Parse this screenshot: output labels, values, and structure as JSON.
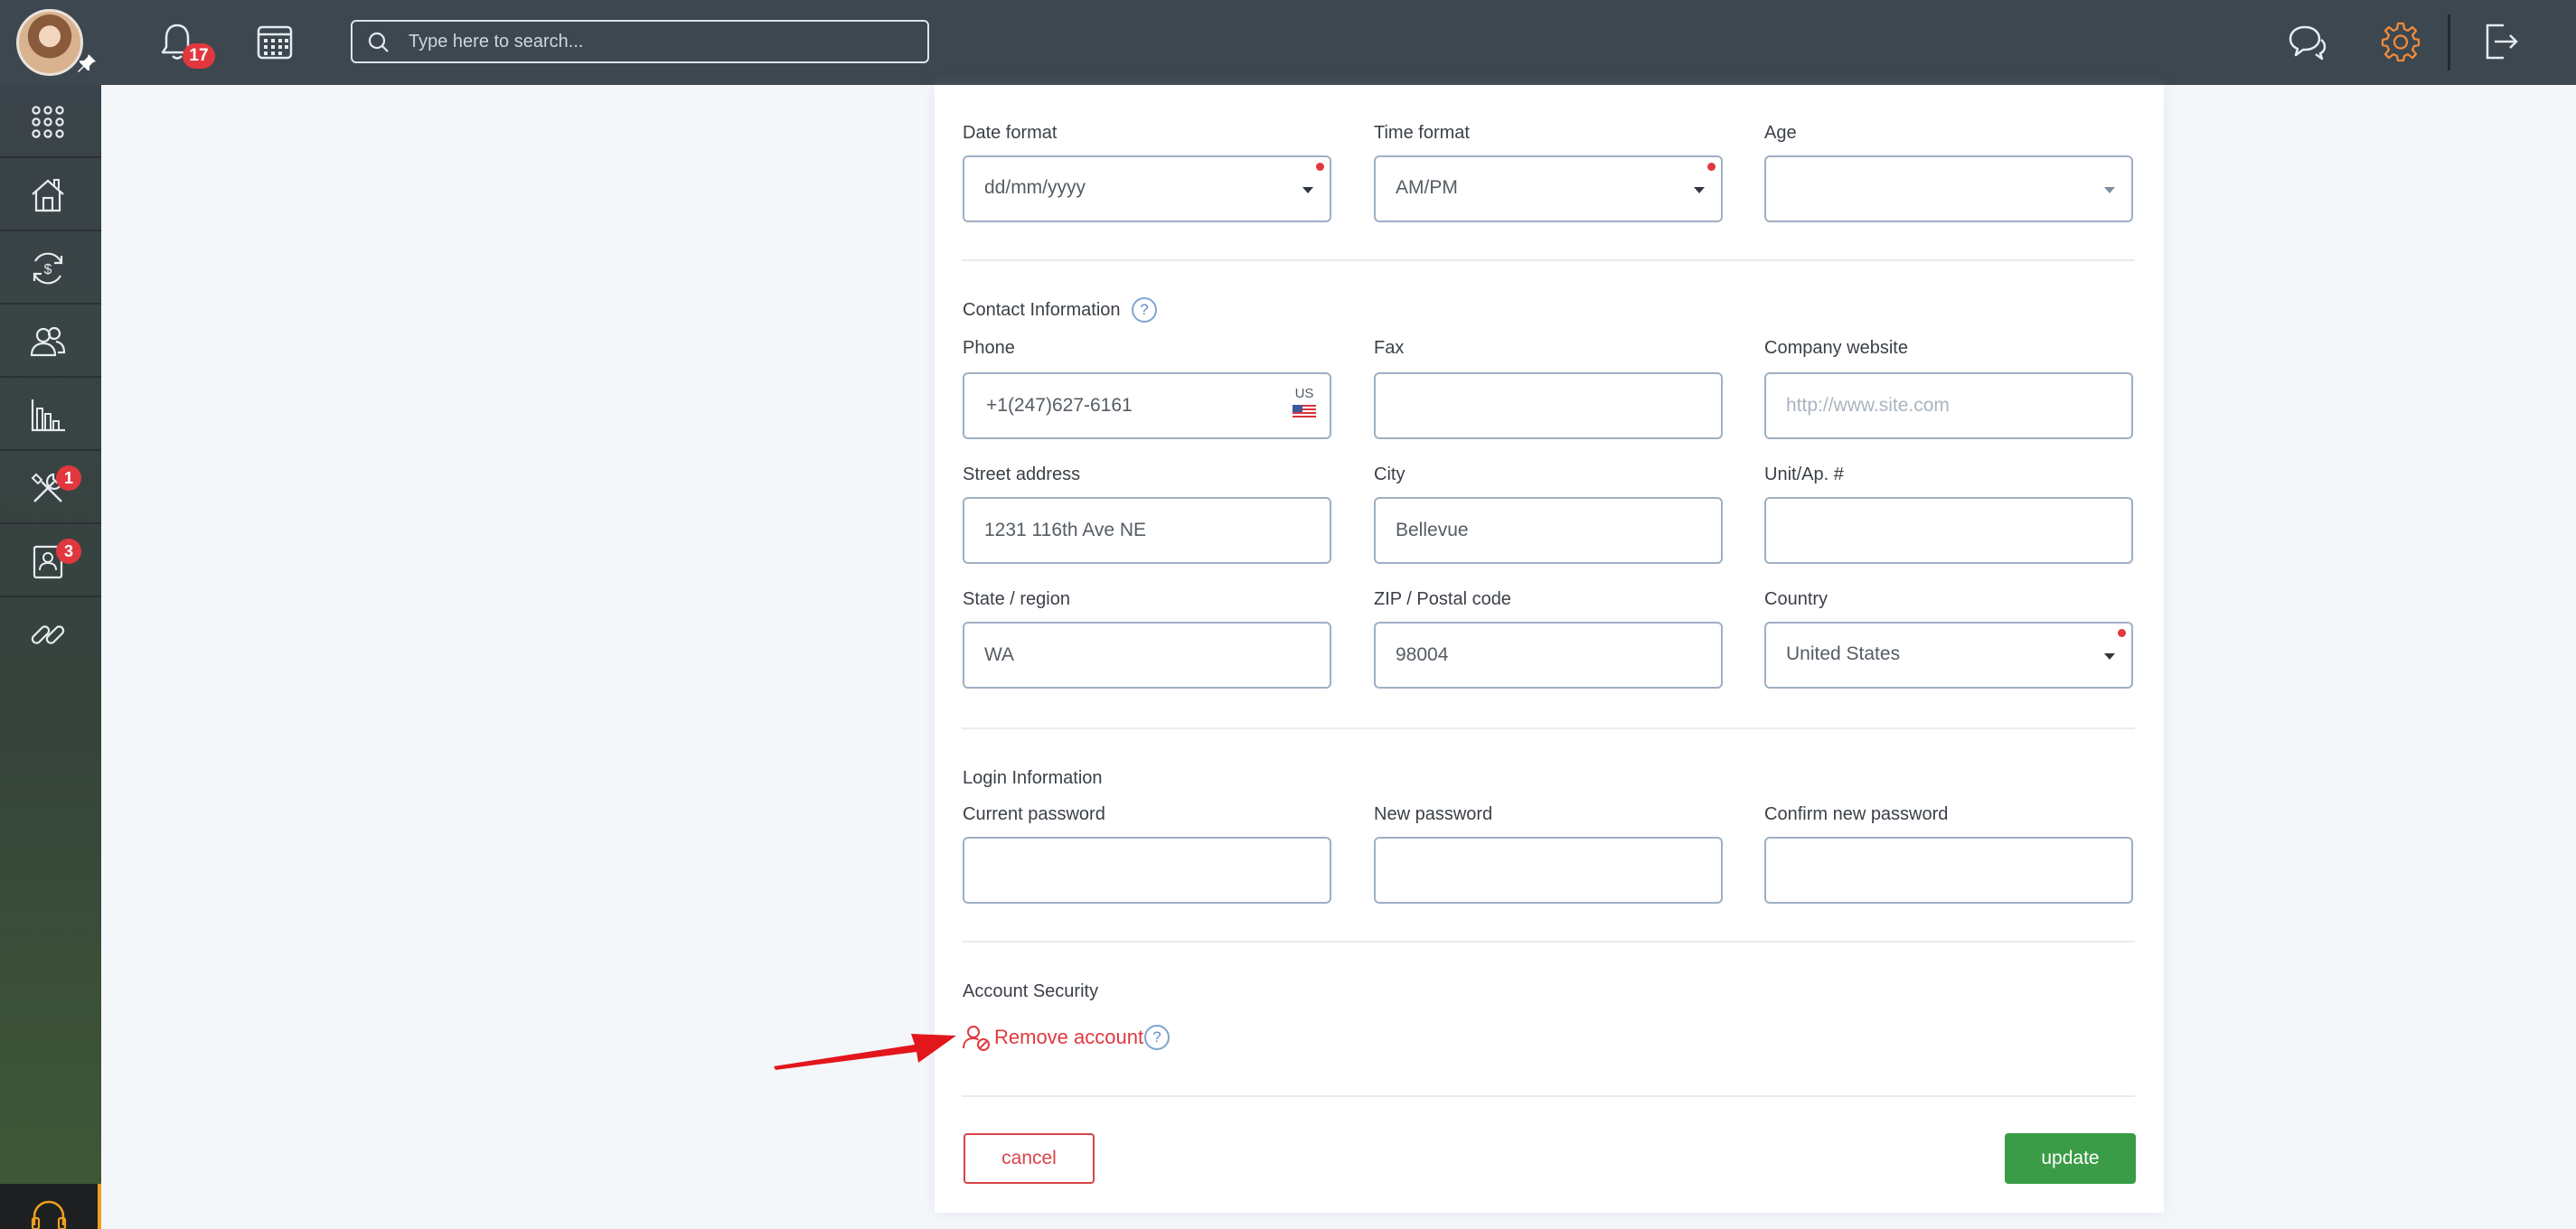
{
  "topbar": {
    "notifications_count": "17",
    "search_placeholder": "Type here to search..."
  },
  "sidebar": {
    "items": [
      {
        "icon": "apps-grid-icon"
      },
      {
        "icon": "home-icon"
      },
      {
        "icon": "money-cycle-icon"
      },
      {
        "icon": "users-icon"
      },
      {
        "icon": "bar-chart-icon"
      },
      {
        "icon": "tools-icon",
        "badge": "1"
      },
      {
        "icon": "contact-card-icon",
        "badge": "3"
      },
      {
        "icon": "link-icon"
      }
    ]
  },
  "form": {
    "preferences": {
      "date_format": {
        "label": "Date format",
        "value": "dd/mm/yyyy"
      },
      "time_format": {
        "label": "Time format",
        "value": "AM/PM"
      },
      "age": {
        "label": "Age",
        "value": ""
      }
    },
    "contact": {
      "title": "Contact Information",
      "phone": {
        "label": "Phone",
        "value": "+1(247)627-6161",
        "country_code": "US"
      },
      "fax": {
        "label": "Fax",
        "value": ""
      },
      "website": {
        "label": "Company website",
        "value": "",
        "placeholder": "http://www.site.com"
      },
      "street": {
        "label": "Street address",
        "value": "1231 116th Ave NE"
      },
      "city": {
        "label": "City",
        "value": "Bellevue"
      },
      "unit": {
        "label": "Unit/Ap. #",
        "value": ""
      },
      "state": {
        "label": "State / region",
        "value": "WA"
      },
      "zip": {
        "label": "ZIP / Postal code",
        "value": "98004"
      },
      "country": {
        "label": "Country",
        "value": "United States"
      }
    },
    "login": {
      "title": "Login Information",
      "current_password": {
        "label": "Current password",
        "value": ""
      },
      "new_password": {
        "label": "New password",
        "value": ""
      },
      "confirm_password": {
        "label": "Confirm new password",
        "value": ""
      }
    },
    "security": {
      "title": "Account Security",
      "remove_account": "Remove account"
    },
    "buttons": {
      "cancel": "cancel",
      "update": "update"
    },
    "help_glyph": "?"
  },
  "colors": {
    "topbar": "#3c4750",
    "danger": "#e0383e",
    "accent_settings": "#f08a3c",
    "primary_green": "#3a9c47",
    "field_border": "#9fb0c3"
  }
}
